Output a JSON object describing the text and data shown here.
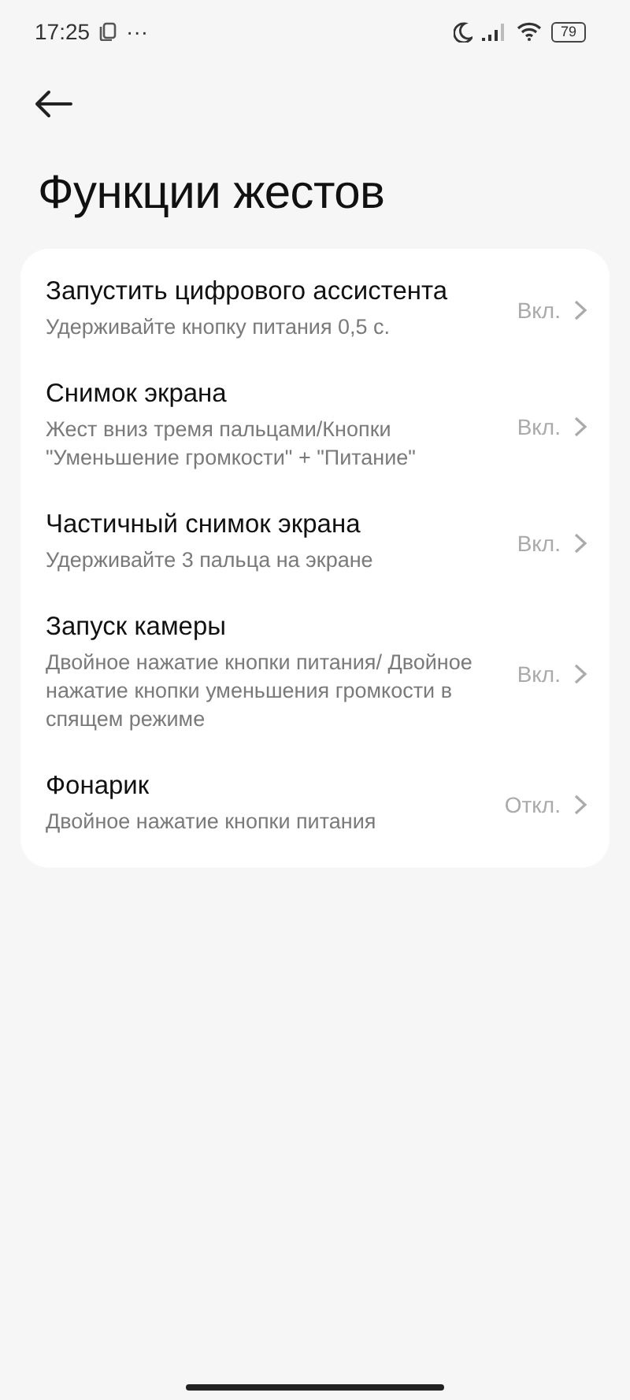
{
  "status_bar": {
    "time": "17:25",
    "more": "···",
    "battery": "79"
  },
  "header": {
    "title": "Функции жестов"
  },
  "settings": [
    {
      "title": "Запустить цифрового ассистента",
      "description": "Удерживайте кнопку питания 0,5 с.",
      "value": "Вкл."
    },
    {
      "title": "Снимок экрана",
      "description": "Жест вниз тремя пальцами/Кнопки \"Уменьшение громкости\" + \"Питание\"",
      "value": "Вкл."
    },
    {
      "title": "Частичный снимок экрана",
      "description": "Удерживайте 3 пальца на экране",
      "value": "Вкл."
    },
    {
      "title": "Запуск камеры",
      "description": "Двойное нажатие кнопки питания/ Двойное нажатие кнопки уменьшения громкости в спящем режиме",
      "value": "Вкл."
    },
    {
      "title": "Фонарик",
      "description": "Двойное нажатие кнопки питания",
      "value": "Откл."
    }
  ]
}
